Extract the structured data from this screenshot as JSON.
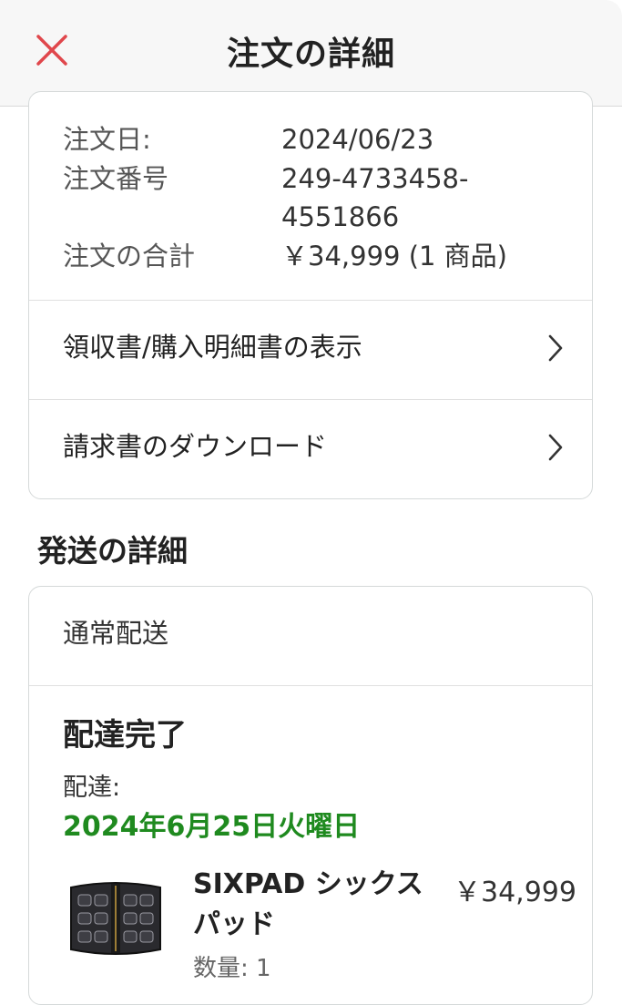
{
  "header": {
    "title": "注文の詳細"
  },
  "order_summary": {
    "date_label": "注文日:",
    "date_value": "2024/06/23",
    "number_label": "注文番号",
    "number_value_line1": "249-4733458-",
    "number_value_line2": "4551866",
    "total_label": "注文の合計",
    "total_value": "￥34,999 (1 商品)",
    "receipt_link": "領収書/購入明細書の表示",
    "invoice_link": "請求書のダウンロード"
  },
  "shipping": {
    "section_title": "発送の詳細",
    "method": "通常配送",
    "status": "配達完了",
    "delivery_label": "配達:",
    "delivery_date": "2024年6月25日火曜日",
    "item": {
      "name": "SIXPAD シックスパッド",
      "price": "￥34,999",
      "quantity": "数量: 1"
    }
  },
  "colors": {
    "close_icon": "#e0474c",
    "delivery_date": "#1f8a1f"
  }
}
